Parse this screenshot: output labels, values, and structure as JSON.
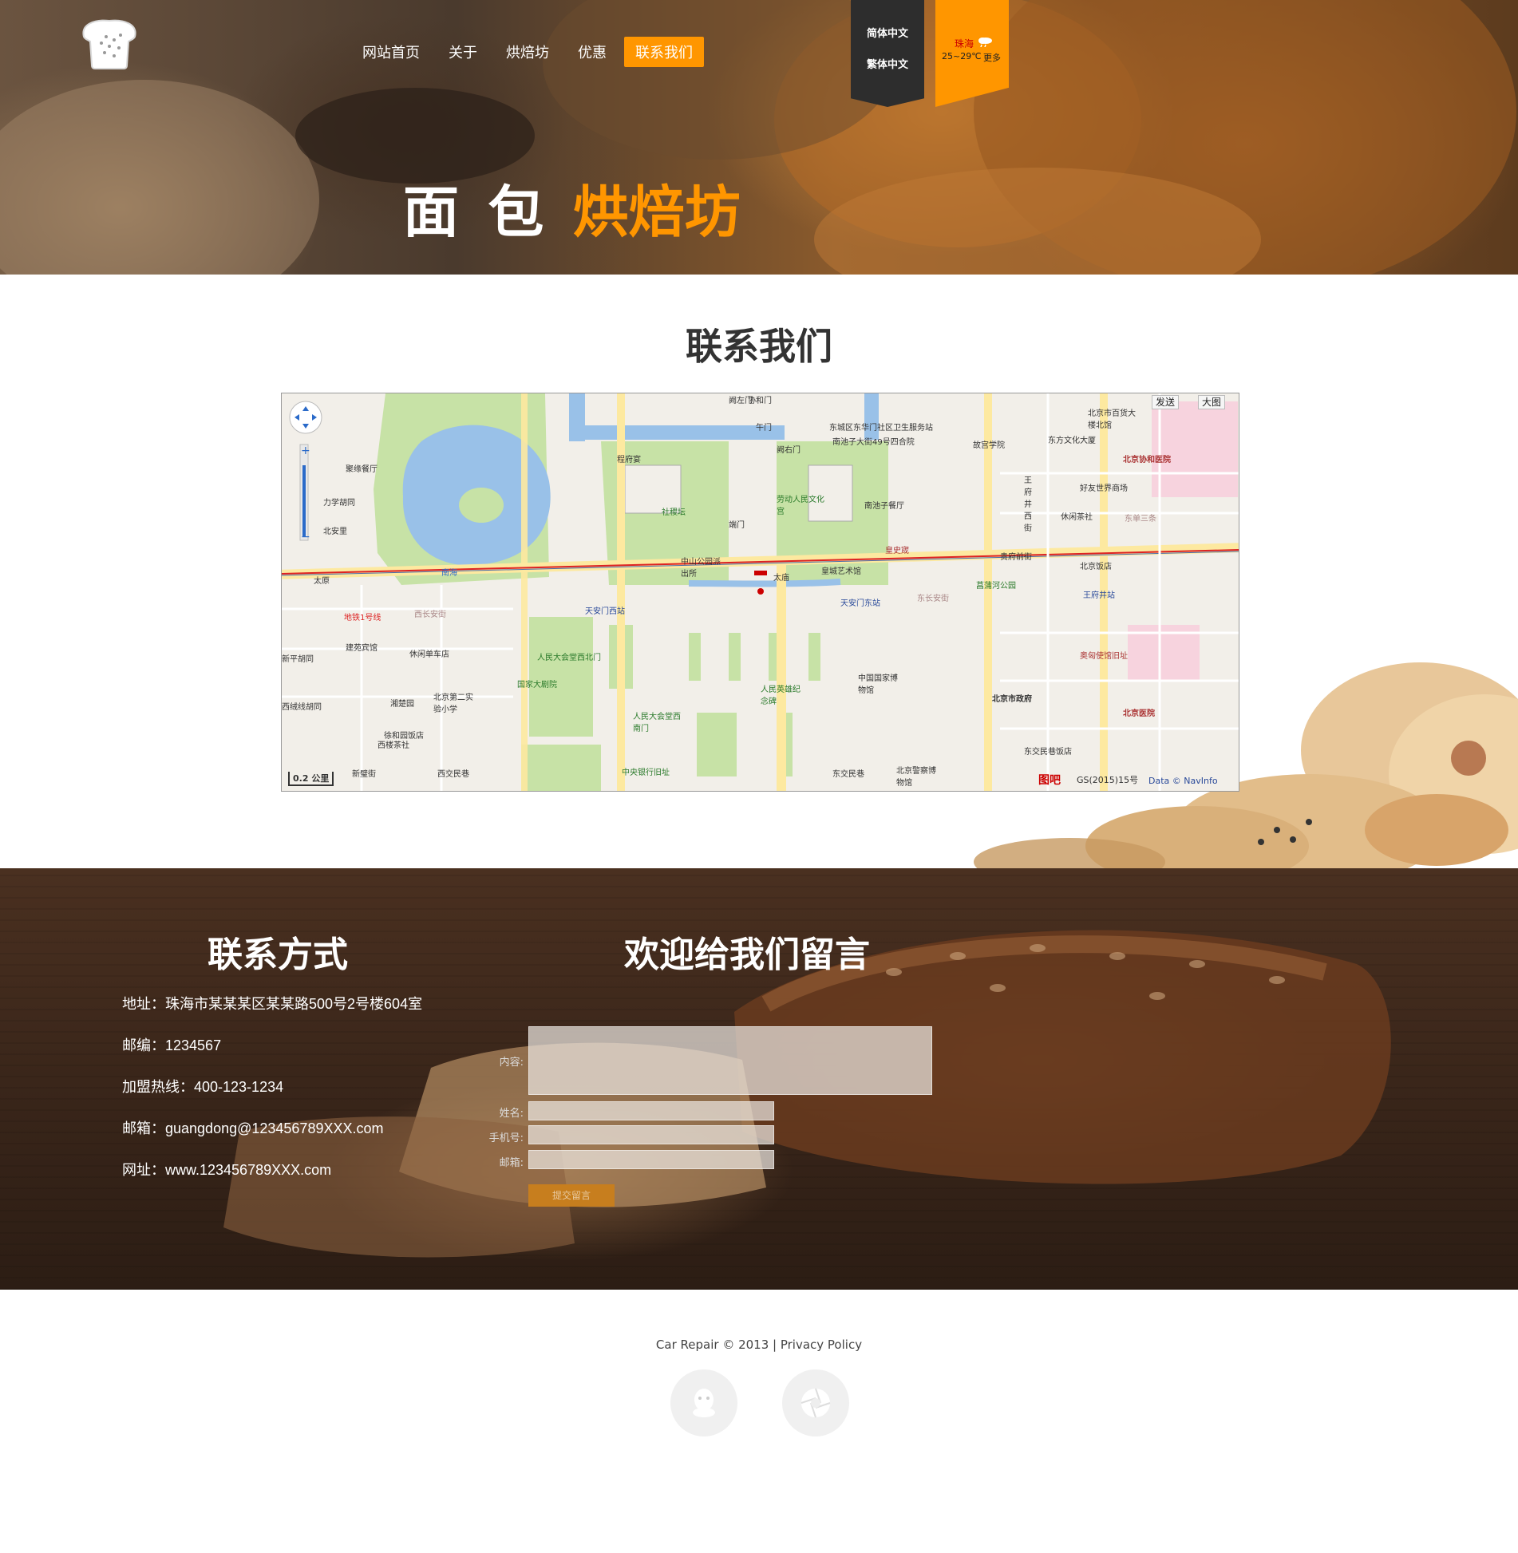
{
  "header": {
    "nav": [
      "网站首页",
      "关于",
      "烘焙坊",
      "优惠",
      "联系我们"
    ],
    "lang": [
      "简体中文",
      "繁体中文"
    ],
    "weather": {
      "city": "珠海",
      "temp": "25~29℃",
      "more": "更多"
    },
    "title_white": "面 包",
    "title_orange": "烘焙坊"
  },
  "contact_title": "联系我们",
  "map": {
    "send_label": "发送",
    "big_label": "大图",
    "scale": "0.2 公里",
    "logo_text": "图吧",
    "license": "GS(2015)15号",
    "data_credit": "Data © NavInfo",
    "labels": {
      "xiehemen": "协和门",
      "wumen": "午门",
      "queyoumen": "阙右门",
      "queyumen": "阙左门",
      "juhuacanting": "聚缘餐厅",
      "lixuehutong": "力学胡同",
      "beianli": "北安里",
      "chengfuyuan": "程府宴",
      "shejitan": "社稷坛",
      "laodong": "劳动人民文化宫",
      "zhongshan": "中山公园派出所",
      "duanmen": "端门",
      "taimiao": "太庙",
      "nanhai": "南海",
      "huangchenggu": "皇城艺术馆",
      "huangshicheng": "皇史宬",
      "nanchizi": "南池子大街49号四合院",
      "dongcheng": "东城区东华门社区卫生服务站",
      "tianan_xi": "天安门西站",
      "tianan_dong": "天安门东站",
      "wangfujing": "王府井站",
      "ditie": "地铁1号线",
      "changan_xi": "西长安街",
      "changan_dong": "东长安街",
      "renmin_xibei": "人民大会堂西北门",
      "guojia": "国家大剧院",
      "renmin_xinan": "人民大会堂西南门",
      "jinianbei": "人民英雄纪念碑",
      "bowuguan": "中国国家博物馆",
      "zhengfu": "北京市政府",
      "zhongyang": "中央银行旧址",
      "dongjiaominxiang": "东交民巷",
      "xijiaominxiang": "西交民巷",
      "xiehe": "北京协和医院",
      "beijing_yiyuan": "北京医院",
      "aoxiong": "奥匈使馆旧址",
      "beijing_fandian": "北京饭店",
      "changpu": "菖蒲河公园",
      "guifuqianjie": "贵府前街",
      "haoyou": "好友世界商场",
      "dongfang": "东方文化大厦",
      "xinhua": "北京市百货大楼北馆",
      "jiangong": "建苑宾馆",
      "dongdan": "东单三条",
      "wangfu_xijie": "王府井西街",
      "gongan": "北京警察博物馆",
      "xinpianyuan": "新平胡同",
      "xijiaoshe": "西绒线胡同",
      "xihuang": "徐和园饭店",
      "shangye": "西楼茶社",
      "dongxi_pinche": "东交民巷饭店",
      "nanchizi_canting": "南池子餐厅",
      "xiuxianchadi": "休闲茶社",
      "gugong": "故宫学院",
      "beijing_ershi": "北京第二实验小学",
      "shengjie": "新璧街",
      "xiuxian_dian": "休闲单车店",
      "huanghou": "湘楚园",
      "taiyuan": "太原"
    }
  },
  "contact": {
    "heading": "联系方式",
    "address": "地址：珠海市某某某区某某路500号2号楼604室",
    "postcode": "邮编：1234567",
    "hotline": "加盟热线：400-123-1234",
    "email": "邮箱：guangdong@123456789XXX.com",
    "website": "网址：www.123456789XXX.com"
  },
  "form": {
    "heading": "欢迎给我们留言",
    "content_label": "内容:",
    "name_label": "姓名:",
    "phone_label": "手机号:",
    "email_label": "邮箱:",
    "submit": "提交留言"
  },
  "footer": {
    "text": "Car Repair © 2013 | Privacy Policy"
  },
  "colors": {
    "accent": "#ff9600",
    "dark_bar": "#2d2d2d"
  }
}
